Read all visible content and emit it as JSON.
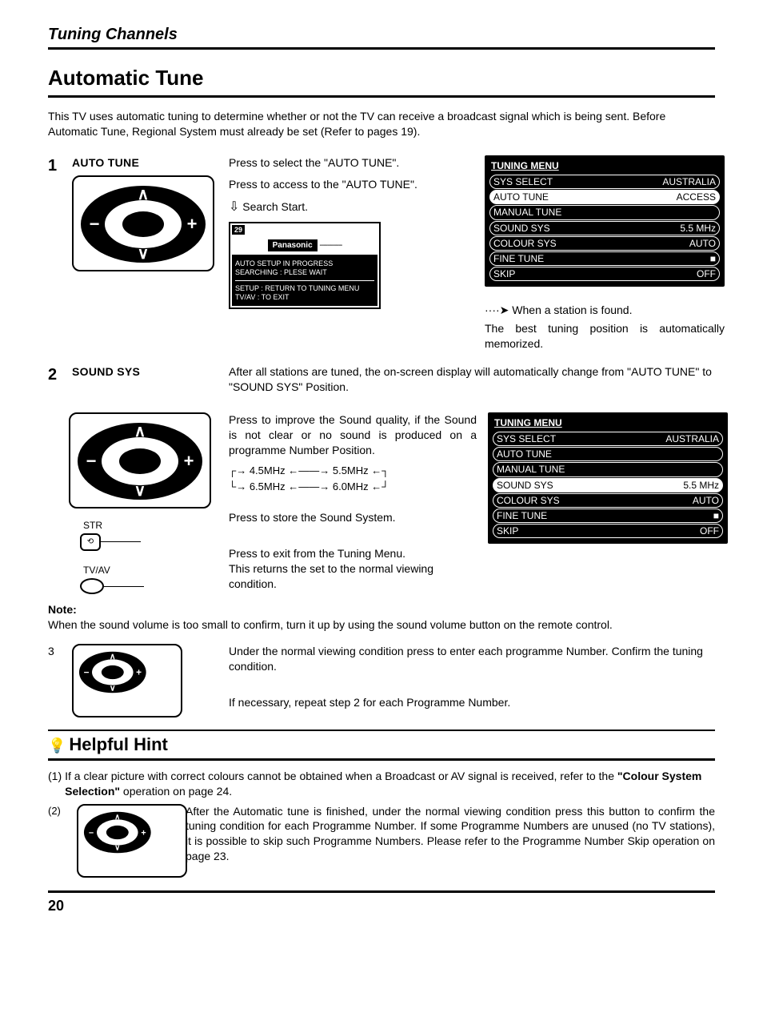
{
  "page": {
    "section": "Tuning Channels",
    "title": "Automatic Tune",
    "intro": "This TV uses automatic tuning to determine whether or not the TV can receive a broadcast signal which is being sent. Before Automatic Tune, Regional System must already be set (Refer to pages 19).",
    "pagenum": "20"
  },
  "step1": {
    "num": "1",
    "label": "AUTO TUNE",
    "l1": "Press to select the \"AUTO TUNE\".",
    "l2": "Press to access to the \"AUTO TUNE\".",
    "search": "Search Start.",
    "screen": {
      "ch": "29",
      "brand": "Panasonic",
      "line1": "AUTO SETUP IN PROGRESS",
      "line2": "SEARCHING : PLESE WAIT",
      "line3": "SETUP  : RETURN TO TUNING MENU",
      "line4": "TV/AV   : TO EXIT"
    },
    "found": "When a station is found.",
    "memo": "The best tuning position is automatically memorized."
  },
  "osd1": {
    "title": "TUNING MENU",
    "rows": [
      {
        "l": "SYS SELECT",
        "r": "AUSTRALIA",
        "hl": false
      },
      {
        "l": "AUTO TUNE",
        "r": "ACCESS",
        "hl": true
      },
      {
        "l": "MANUAL TUNE",
        "r": "",
        "hl": false
      },
      {
        "l": "SOUND SYS",
        "r": "5.5 MHz",
        "hl": false
      },
      {
        "l": "COLOUR SYS",
        "r": "AUTO",
        "hl": false
      },
      {
        "l": "FINE TUNE",
        "r": "■",
        "hl": false
      },
      {
        "l": "SKIP",
        "r": "OFF",
        "hl": false
      }
    ]
  },
  "step2": {
    "num": "2",
    "label": "SOUND SYS",
    "intro": "After all stations are tuned, the on-screen display will automatically change from \"AUTO TUNE\" to \"SOUND SYS\" Position.",
    "l1": "Press to improve the Sound quality, if the Sound is not clear or no sound is produced on a programme Number Position.",
    "freq": {
      "a": "4.5MHz",
      "b": "5.5MHz",
      "c": "6.5MHz",
      "d": "6.0MHz"
    },
    "str_label": "STR",
    "str_text": "Press to store the Sound System.",
    "tvav_label": "TV/AV",
    "tvav_text1": "Press to exit from the Tuning Menu.",
    "tvav_text2": "This returns the set to the normal viewing condition."
  },
  "osd2": {
    "title": "TUNING MENU",
    "rows": [
      {
        "l": "SYS SELECT",
        "r": "AUSTRALIA",
        "hl": false
      },
      {
        "l": "AUTO TUNE",
        "r": "",
        "hl": false
      },
      {
        "l": "MANUAL TUNE",
        "r": "",
        "hl": false
      },
      {
        "l": "SOUND SYS",
        "r": "5.5 MHz",
        "hl": true
      },
      {
        "l": "COLOUR SYS",
        "r": "AUTO",
        "hl": false
      },
      {
        "l": "FINE TUNE",
        "r": "■",
        "hl": false
      },
      {
        "l": "SKIP",
        "r": "OFF",
        "hl": false
      }
    ]
  },
  "note": {
    "label": "Note:",
    "text": "When the sound volume is too small to confirm, turn it up by using the sound volume button on the remote control."
  },
  "step3": {
    "num": "3",
    "l1": "Under the normal viewing condition press to enter each programme Number. Confirm the tuning condition.",
    "l2": "If necessary, repeat step 2 for each Programme Number."
  },
  "hint": {
    "title": "Helpful Hint",
    "n1": "(1)",
    "t1a": "If a clear picture with correct colours cannot be obtained when a Broadcast or AV signal is received, refer to the ",
    "t1b": "\"Colour System Selection\"",
    "t1c": " operation on page 24.",
    "n2": "(2)",
    "t2": "After the Automatic tune is finished, under the normal viewing condition press this button to confirm the tuning condition for each Programme Number. If some Programme Numbers are unused (no TV stations), it is possible to skip such Programme Numbers. Please refer to the Programme Number Skip operation on page 23."
  }
}
